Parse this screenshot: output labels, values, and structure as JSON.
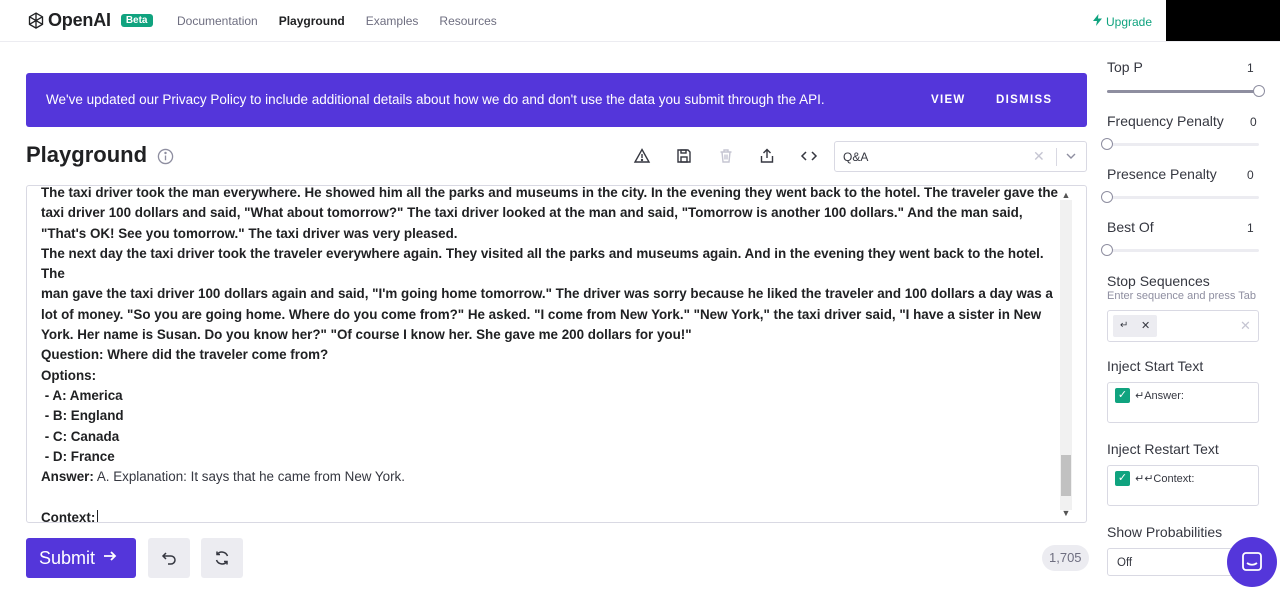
{
  "nav": {
    "brand": "OpenAI",
    "badge": "Beta",
    "links": [
      "Documentation",
      "Playground",
      "Examples",
      "Resources"
    ],
    "upgrade": "Upgrade"
  },
  "banner": {
    "text": "We've updated our Privacy Policy to include additional details about how we do and don't use the data you submit through the API.",
    "view": "VIEW",
    "dismiss": "DISMISS"
  },
  "page": {
    "title": "Playground",
    "preset": "Q&A"
  },
  "editor": {
    "lines": [
      "The taxi driver took the man everywhere. He showed him all the parks and museums in the city. In the evening they went back to the hotel. The traveler gave the",
      "taxi driver 100 dollars and said, \"What about tomorrow?\" The taxi driver looked at the man and said, \"Tomorrow is another 100 dollars.\" And the man said,",
      "\"That's OK! See you tomorrow.\" The taxi driver was very pleased.",
      "The next day the taxi driver took the traveler everywhere again. They visited all the parks and museums again. And in the evening they went back to the hotel. The",
      "man gave the taxi driver 100 dollars again and said, \"I'm going home tomorrow.\" The driver was sorry because he liked the traveler and 100 dollars a day was a",
      "lot of money. \"So you are going home. Where do you come from?\" He asked. \"I come from New York.\" \"New York,\" the taxi driver said, \"I have a sister in New",
      "York. Her name is Susan. Do you know her?\" \"Of course I know her. She gave me 200 dollars for you!\"",
      "Question: Where did the traveler come from?",
      "Options:",
      " - A: America",
      " - B: England",
      " - C: Canada",
      " - D: France"
    ],
    "answer_label": "Answer:",
    "answer_text": " A. Explanation: It says that he came from New York.",
    "context_label": "Context:"
  },
  "controls": {
    "submit": "Submit",
    "token_count": "1,705"
  },
  "panel": {
    "top_p": {
      "label": "Top P",
      "value": "1",
      "fraction": 1.0
    },
    "frequency_penalty": {
      "label": "Frequency Penalty",
      "value": "0",
      "fraction": 0.0
    },
    "presence_penalty": {
      "label": "Presence Penalty",
      "value": "0",
      "fraction": 0.0
    },
    "best_of": {
      "label": "Best Of",
      "value": "1",
      "fraction": 0.0
    },
    "stop_sequences": {
      "label": "Stop Sequences",
      "hint": "Enter sequence and press Tab",
      "chip": "↵"
    },
    "inject_start": {
      "label": "Inject Start Text",
      "value": "↵Answer:"
    },
    "inject_restart": {
      "label": "Inject Restart Text",
      "value": "↵↵Context:"
    },
    "show_probabilities": {
      "label": "Show Probabilities",
      "value": "Off"
    }
  },
  "colors": {
    "accent": "#5436da",
    "brand_green": "#10a37f"
  },
  "icons": [
    "openai-logo-icon",
    "bolt-icon",
    "info-icon",
    "warning-icon",
    "save-icon",
    "trash-icon",
    "share-icon",
    "code-icon",
    "arrow-right-icon",
    "undo-icon",
    "refresh-icon",
    "chat-icon"
  ]
}
